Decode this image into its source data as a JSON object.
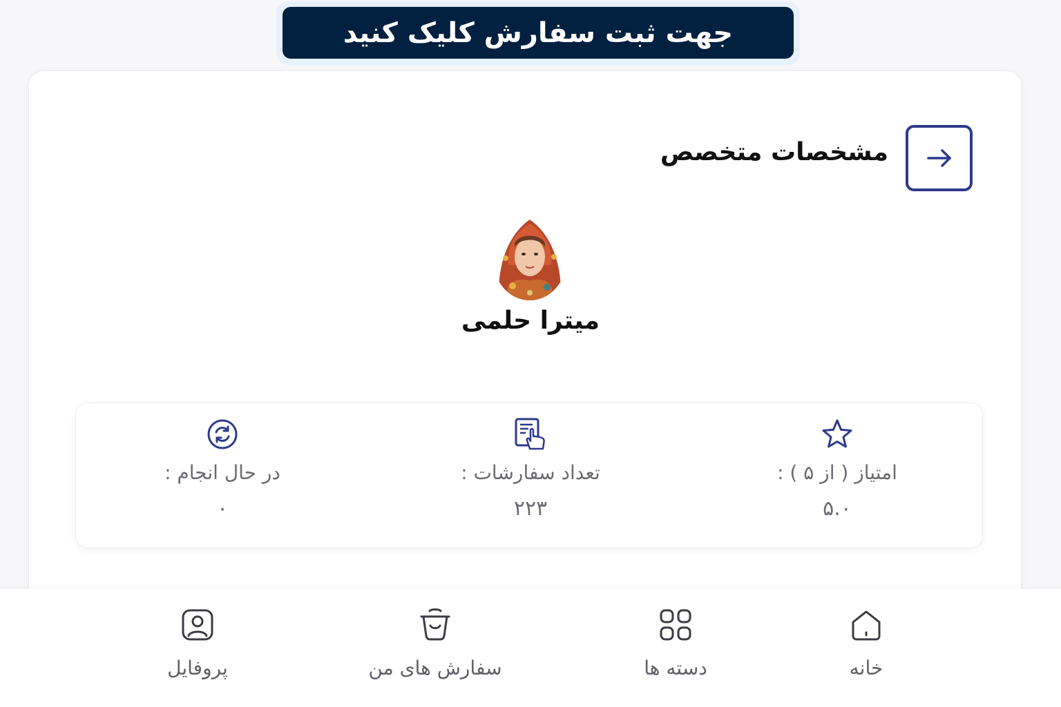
{
  "banner": {
    "text": "جهت ثبت سفارش کلیک کنید"
  },
  "header": {
    "title": "مشخصات متخصص",
    "back_icon": "arrow-right-icon"
  },
  "expert": {
    "name": "میترا حلمی",
    "avatar_icon": "expert-avatar"
  },
  "stats": [
    {
      "icon": "star-icon",
      "label": "امتیاز ( از ۵ ) :",
      "value": "۵.۰"
    },
    {
      "icon": "hand-pointer-doc-icon",
      "label": "تعداد سفارشات :",
      "value": "۲۲۳"
    },
    {
      "icon": "refresh-circle-icon",
      "label": "در حال انجام :",
      "value": "۰"
    }
  ],
  "nav": [
    {
      "icon": "home-icon",
      "label": "خانه"
    },
    {
      "icon": "categories-icon",
      "label": "دسته ها"
    },
    {
      "icon": "basket-icon",
      "label": "سفارش های من"
    },
    {
      "icon": "profile-icon",
      "label": "پروفایل"
    }
  ],
  "colors": {
    "primary": "#2d3a8c",
    "banner_bg": "#02203f"
  }
}
